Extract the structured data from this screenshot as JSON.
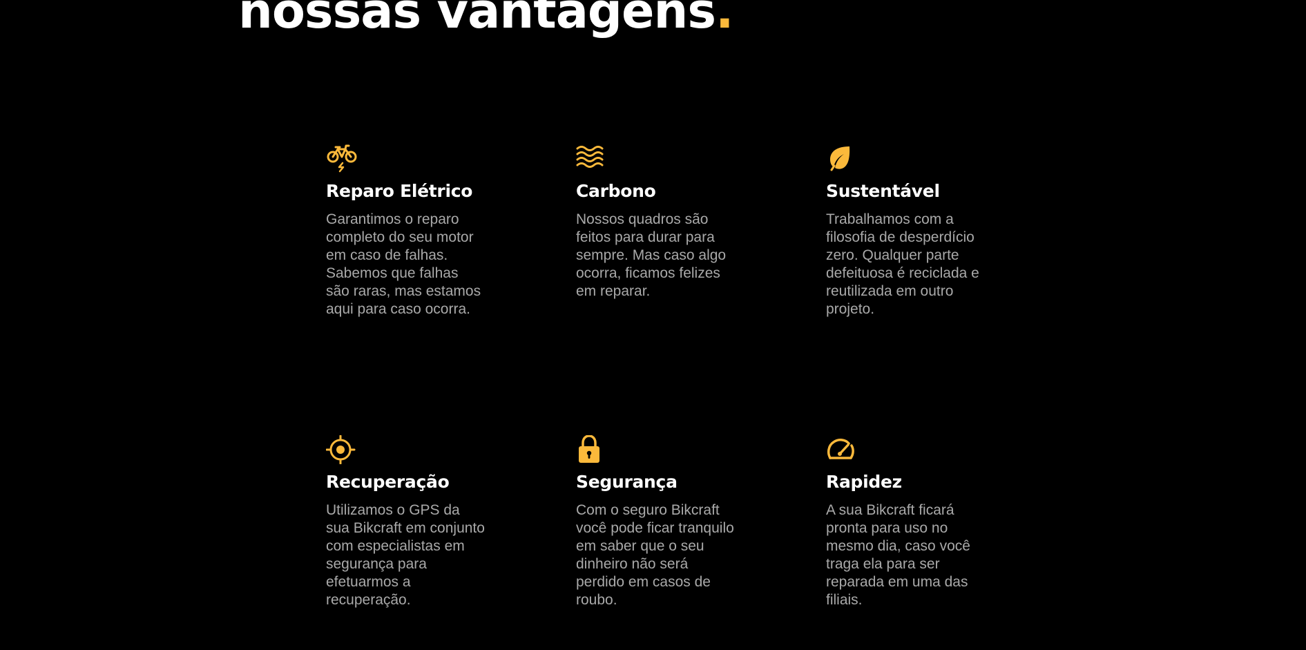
{
  "section": {
    "title": "nossas vantagens",
    "title_dot": "."
  },
  "colors": {
    "background": "#000000",
    "accent": "#FBB93B",
    "heading": "#FFFFFF",
    "body_text": "#A9A9A9"
  },
  "features": [
    {
      "icon": "electric-bike-icon",
      "title": "Reparo Elétrico",
      "text": "Garantimos o reparo completo do seu motor em caso de falhas. Sabemos que falhas são raras, mas estamos aqui para caso ocorra."
    },
    {
      "icon": "waves-icon",
      "title": "Carbono",
      "text": "Nossos quadros são feitos para durar para sempre. Mas caso algo ocorra, ficamos felizes em reparar."
    },
    {
      "icon": "leaf-icon",
      "title": "Sustentável",
      "text": "Trabalhamos com a filosofia de desperdício zero. Qualquer parte defeituosa é reciclada e reutilizada em outro projeto."
    },
    {
      "icon": "target-icon",
      "title": "Recuperação",
      "text": "Utilizamos o GPS da sua Bikcraft em conjunto com especialistas em segurança para efetuarmos a recuperação."
    },
    {
      "icon": "lock-icon",
      "title": "Segurança",
      "text": "Com o seguro Bikcraft você pode ficar tranquilo em saber que o seu dinheiro não será perdido em casos de roubo."
    },
    {
      "icon": "speedometer-icon",
      "title": "Rapidez",
      "text": "A sua Bikcraft ficará pronta para uso no mesmo dia, caso você traga ela para ser reparada em uma das filiais."
    }
  ]
}
